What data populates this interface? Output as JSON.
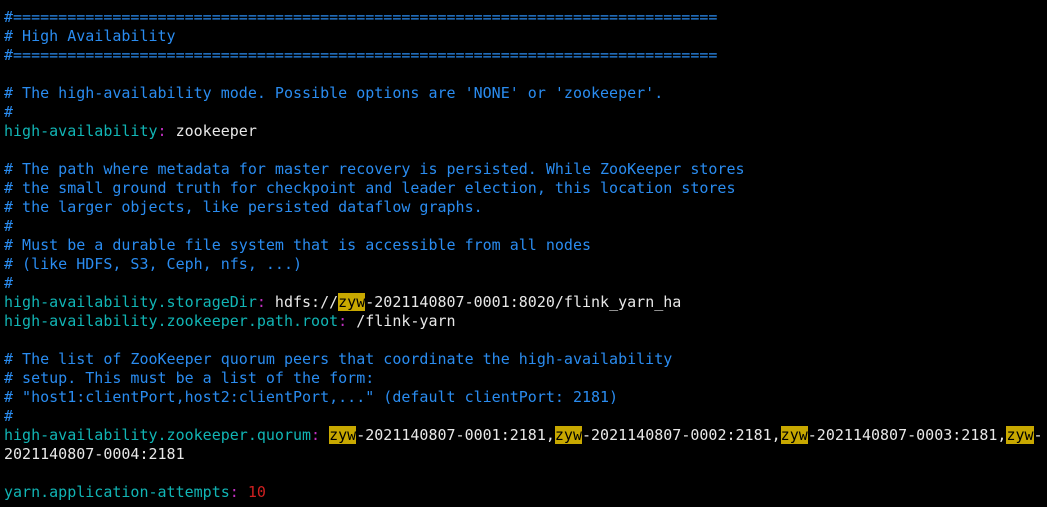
{
  "lines": [
    {
      "type": "comment",
      "text": "#=============================================================================="
    },
    {
      "type": "comment",
      "text": "# High Availability"
    },
    {
      "type": "comment",
      "text": "#=============================================================================="
    },
    {
      "type": "blank",
      "text": ""
    },
    {
      "type": "comment",
      "text": "# The high-availability mode. Possible options are 'NONE' or 'zookeeper'."
    },
    {
      "type": "comment",
      "text": "#"
    },
    {
      "type": "kv",
      "key": "high-availability",
      "sep": ":",
      "value": [
        {
          "t": " zookeeper"
        }
      ]
    },
    {
      "type": "blank",
      "text": ""
    },
    {
      "type": "comment",
      "text": "# The path where metadata for master recovery is persisted. While ZooKeeper stores"
    },
    {
      "type": "comment",
      "text": "# the small ground truth for checkpoint and leader election, this location stores"
    },
    {
      "type": "comment",
      "text": "# the larger objects, like persisted dataflow graphs."
    },
    {
      "type": "comment",
      "text": "#"
    },
    {
      "type": "comment",
      "text": "# Must be a durable file system that is accessible from all nodes"
    },
    {
      "type": "comment",
      "text": "# (like HDFS, S3, Ceph, nfs, ...)"
    },
    {
      "type": "comment",
      "text": "#"
    },
    {
      "type": "kv",
      "key": "high-availability.storageDir",
      "sep": ":",
      "value": [
        {
          "t": " hdfs://"
        },
        {
          "t": "zyw",
          "hl": true
        },
        {
          "t": "-2021140807-0001:8020/flink_yarn_ha"
        }
      ]
    },
    {
      "type": "kv",
      "key": "high-availability.zookeeper.path.root",
      "sep": ":",
      "value": [
        {
          "t": " /flink-yarn"
        }
      ]
    },
    {
      "type": "blank",
      "text": ""
    },
    {
      "type": "comment",
      "text": "# The list of ZooKeeper quorum peers that coordinate the high-availability"
    },
    {
      "type": "comment",
      "text": "# setup. This must be a list of the form:"
    },
    {
      "type": "comment",
      "text": "# \"host1:clientPort,host2:clientPort,...\" (default clientPort: 2181)"
    },
    {
      "type": "comment",
      "text": "#"
    },
    {
      "type": "kv",
      "key": "high-availability.zookeeper.quorum",
      "sep": ":",
      "value": [
        {
          "t": " "
        },
        {
          "t": "zyw",
          "hl": true
        },
        {
          "t": "-2021140807-0001:2181,"
        },
        {
          "t": "zyw",
          "hl": true
        },
        {
          "t": "-2021140807-0002:2181,"
        },
        {
          "t": "zyw",
          "hl": true
        },
        {
          "t": "-2021140807-0003:2181,"
        },
        {
          "t": "zyw",
          "hl": true
        },
        {
          "t": "-"
        }
      ]
    },
    {
      "type": "plain",
      "text": "2021140807-0004:2181"
    },
    {
      "type": "blank",
      "text": ""
    },
    {
      "type": "kv",
      "key": "yarn.application-attempts",
      "sep": ":",
      "value": [
        {
          "t": " "
        },
        {
          "t": "10",
          "num": true
        }
      ]
    }
  ],
  "colors": {
    "comment": "#2a8cf0",
    "key": "#11b5b5",
    "separator": "#c030c0",
    "highlight": "#c8a800",
    "number": "#d02020"
  }
}
